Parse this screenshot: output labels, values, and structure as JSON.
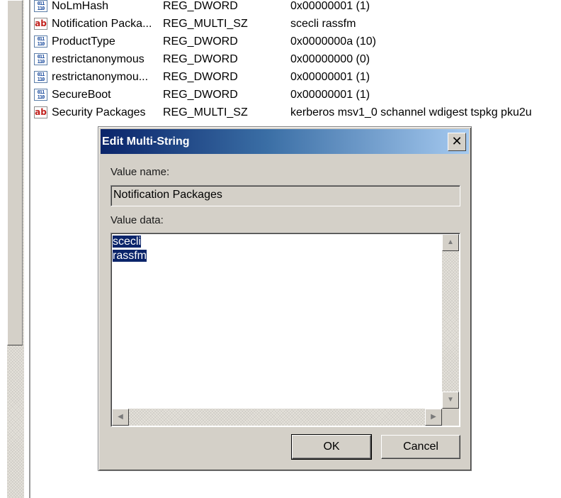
{
  "registry_values": [
    {
      "name": "NoLmHash",
      "type": "REG_DWORD",
      "data": "0x00000001 (1)",
      "icon": "binary-value-icon"
    },
    {
      "name": "Notification Packa...",
      "type": "REG_MULTI_SZ",
      "data": "scecli rassfm",
      "icon": "string-value-icon"
    },
    {
      "name": "ProductType",
      "type": "REG_DWORD",
      "data": "0x0000000a (10)",
      "icon": "binary-value-icon"
    },
    {
      "name": "restrictanonymous",
      "type": "REG_DWORD",
      "data": "0x00000000 (0)",
      "icon": "binary-value-icon"
    },
    {
      "name": "restrictanonymou...",
      "type": "REG_DWORD",
      "data": "0x00000001 (1)",
      "icon": "binary-value-icon"
    },
    {
      "name": "SecureBoot",
      "type": "REG_DWORD",
      "data": "0x00000001 (1)",
      "icon": "binary-value-icon"
    },
    {
      "name": "Security Packages",
      "type": "REG_MULTI_SZ",
      "data": "kerberos msv1_0 schannel wdigest tspkg pku2u",
      "icon": "string-value-icon"
    }
  ],
  "dialog": {
    "title": "Edit Multi-String",
    "close_glyph": "✕",
    "value_name_label": "Value name:",
    "value_name": "Notification Packages",
    "value_data_label": "Value data:",
    "value_data_lines": [
      "scecli",
      "rassfm"
    ],
    "ok_label": "OK",
    "cancel_label": "Cancel"
  },
  "icons": {
    "binary_glyph_top": "011",
    "binary_glyph_bottom": "110",
    "string_glyph": "ab"
  },
  "colors": {
    "title_start": "#0a246a",
    "title_end": "#a6caf0",
    "selection": "#0a246a",
    "face": "#d4d0c8"
  }
}
